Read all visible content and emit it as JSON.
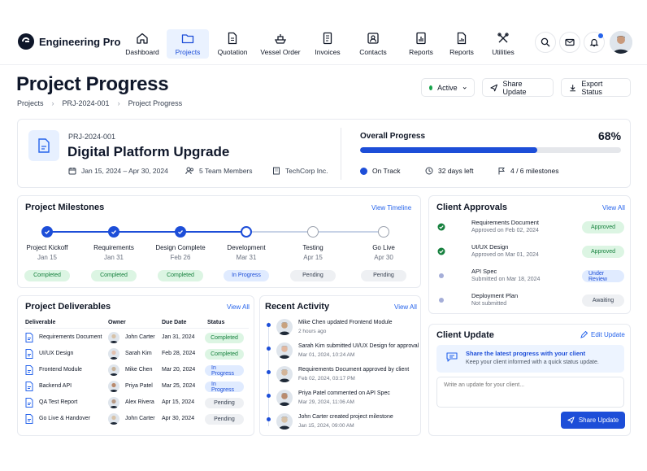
{
  "app": {
    "name": "Engineering Pro"
  },
  "nav": [
    {
      "label": "Dashboard",
      "icon": "home-icon"
    },
    {
      "label": "Projects",
      "icon": "folder-icon",
      "active": true
    },
    {
      "label": "Quotation",
      "icon": "quote-doc-icon"
    },
    {
      "label": "Vessel Order",
      "icon": "ship-icon"
    },
    {
      "label": "Invoices",
      "icon": "invoice-icon"
    },
    {
      "label": "Contacts",
      "icon": "contact-icon"
    },
    {
      "label": "Reports",
      "icon": "report-icon"
    },
    {
      "label": "Reports",
      "icon": "report-doc-icon"
    },
    {
      "label": "Utilities",
      "icon": "tools-icon"
    }
  ],
  "page": {
    "title": "Project Progress",
    "breadcrumb": [
      "Projects",
      "PRJ-2024-001",
      "Project Progress"
    ],
    "status_select": "Active",
    "share_update": "Share Update",
    "export_status": "Export Status"
  },
  "project": {
    "id": "PRJ-2024-001",
    "name": "Digital Platform Upgrade",
    "dates": "Jan 15, 2024 – Apr 30, 2024",
    "team": "5 Team Members",
    "client": "TechCorp Inc.",
    "overall_label": "Overall Progress",
    "overall_percent_text": "68%",
    "overall_percent": 68,
    "status": "On Track",
    "days_left": "32 days left",
    "milestones_done": "4 / 6 milestones"
  },
  "milestones": {
    "title": "Project Milestones",
    "link": "View Timeline",
    "items": [
      {
        "name": "Project Kickoff",
        "date": "Jan 15",
        "status": "Completed",
        "state": "done"
      },
      {
        "name": "Requirements",
        "date": "Jan 31",
        "status": "Completed",
        "state": "done"
      },
      {
        "name": "Design Complete",
        "date": "Feb 26",
        "status": "Completed",
        "state": "done"
      },
      {
        "name": "Development",
        "date": "Mar 31",
        "status": "In Progress",
        "state": "current"
      },
      {
        "name": "Testing",
        "date": "Apr 15",
        "status": "Pending",
        "state": "pending"
      },
      {
        "name": "Go Live",
        "date": "Apr 30",
        "status": "Pending",
        "state": "pending"
      }
    ]
  },
  "approvals": {
    "title": "Client Approvals",
    "link": "View All",
    "items": [
      {
        "name": "Requirements Document",
        "sub": "Approved on Feb 02, 2024",
        "status": "Approved",
        "state": "done"
      },
      {
        "name": "UI/UX Design",
        "sub": "Approved on Mar 01, 2024",
        "status": "Approved",
        "state": "done"
      },
      {
        "name": "API Spec",
        "sub": "Submitted on Mar 18, 2024",
        "status": "Under Review",
        "state": "review"
      },
      {
        "name": "Deployment Plan",
        "sub": "Not submitted",
        "status": "Awaiting",
        "state": "wait"
      }
    ]
  },
  "deliverables": {
    "title": "Project Deliverables",
    "link": "View All",
    "columns": [
      "Deliverable",
      "Owner",
      "Due Date",
      "Status"
    ],
    "rows": [
      {
        "name": "Requirements Document",
        "owner": "John Carter",
        "due": "Jan 31, 2024",
        "status": "Completed",
        "state": "done"
      },
      {
        "name": "UI/UX Design",
        "owner": "Sarah Kim",
        "due": "Feb 28, 2024",
        "status": "Completed",
        "state": "done"
      },
      {
        "name": "Frontend Module",
        "owner": "Mike Chen",
        "due": "Mar 20, 2024",
        "status": "In Progress",
        "state": "current"
      },
      {
        "name": "Backend API",
        "owner": "Priya Patel",
        "due": "Mar 25, 2024",
        "status": "In Progress",
        "state": "current"
      },
      {
        "name": "QA Test Report",
        "owner": "Alex Rivera",
        "due": "Apr 15, 2024",
        "status": "Pending",
        "state": "pending"
      },
      {
        "name": "Go Live & Handover",
        "owner": "John Carter",
        "due": "Apr 30, 2024",
        "status": "Pending",
        "state": "pending"
      }
    ]
  },
  "activity": {
    "title": "Recent Activity",
    "link": "View All",
    "items": [
      {
        "text": "Mike Chen updated Frontend Module",
        "time": "2 hours ago"
      },
      {
        "text": "Sarah Kim submitted UI/UX Design for approval",
        "time": "Mar 01, 2024, 10:24 AM"
      },
      {
        "text": "Requirements Document approved by client",
        "time": "Feb 02, 2024, 03:17 PM"
      },
      {
        "text": "Priya Patel commented on API Spec",
        "time": "Mar 29, 2024, 11:06 AM"
      },
      {
        "text": "John Carter created project milestone",
        "time": "Jan 15, 2024, 09:00 AM"
      }
    ]
  },
  "client_update": {
    "title": "Client Update",
    "edit": "Edit Update",
    "banner_title": "Share the latest progress with your client",
    "banner_sub": "Keep your client informed with a quick status update.",
    "placeholder": "Write an update for your client...",
    "button": "Share Update"
  },
  "colors": {
    "accent": "#2563eb",
    "green": "#16a34a",
    "dark": "#0f172a"
  }
}
